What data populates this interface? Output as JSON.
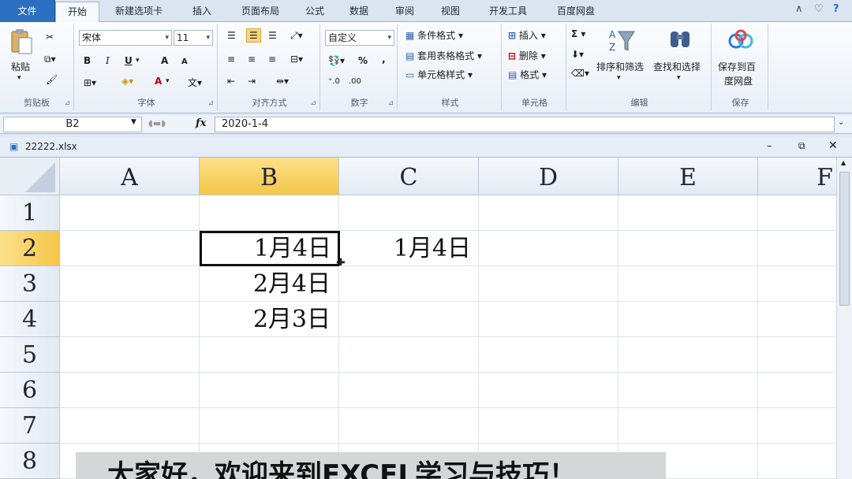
{
  "ribbon_tabs": [
    "文件",
    "开始",
    "新建选项卡",
    "插入",
    "页面布局",
    "公式",
    "数据",
    "审阅",
    "视图",
    "开发工具",
    "百度网盘"
  ],
  "clipboard": {
    "paste": "粘贴",
    "label": "剪贴板"
  },
  "font": {
    "name": "宋体",
    "size": "11",
    "label": "字体",
    "bold": "B",
    "italic": "I",
    "underline": "U",
    "grow": "A",
    "shrink": "A",
    "fontcolor": "A"
  },
  "alignment": {
    "label": "对齐方式"
  },
  "number": {
    "format": "自定义",
    "label": "数字",
    "percent": "%",
    "comma": ","
  },
  "styles": {
    "conditional": "条件格式",
    "table": "套用表格格式",
    "cell": "单元格样式",
    "label": "样式"
  },
  "cells": {
    "insert": "插入",
    "delete": "删除",
    "format": "格式",
    "label": "单元格"
  },
  "editing": {
    "sort": "排序和筛选",
    "find": "查找和选择",
    "label": "编辑",
    "sum": "Σ"
  },
  "save": {
    "line1": "保存到百",
    "line2": "度网盘",
    "label": "保存"
  },
  "formula_bar": {
    "name_box": "B2",
    "fx": "fx",
    "value": "2020-1-4"
  },
  "workbook": {
    "title": "22222.xlsx"
  },
  "sheet": {
    "columns": [
      "A",
      "B",
      "C",
      "D",
      "E",
      "F"
    ],
    "rows": [
      "1",
      "2",
      "3",
      "4",
      "5",
      "6",
      "7",
      "8"
    ],
    "active_cell": "B2",
    "cells": {
      "B2": "1月4日",
      "C2": "1月4日",
      "B3": "2月4日",
      "B4": "2月3日"
    }
  },
  "caption": "大家好，欢迎来到EXCEL学习与技巧！",
  "colors": {
    "accent": "#2a6fc1",
    "selected_header": "#f5c648"
  }
}
